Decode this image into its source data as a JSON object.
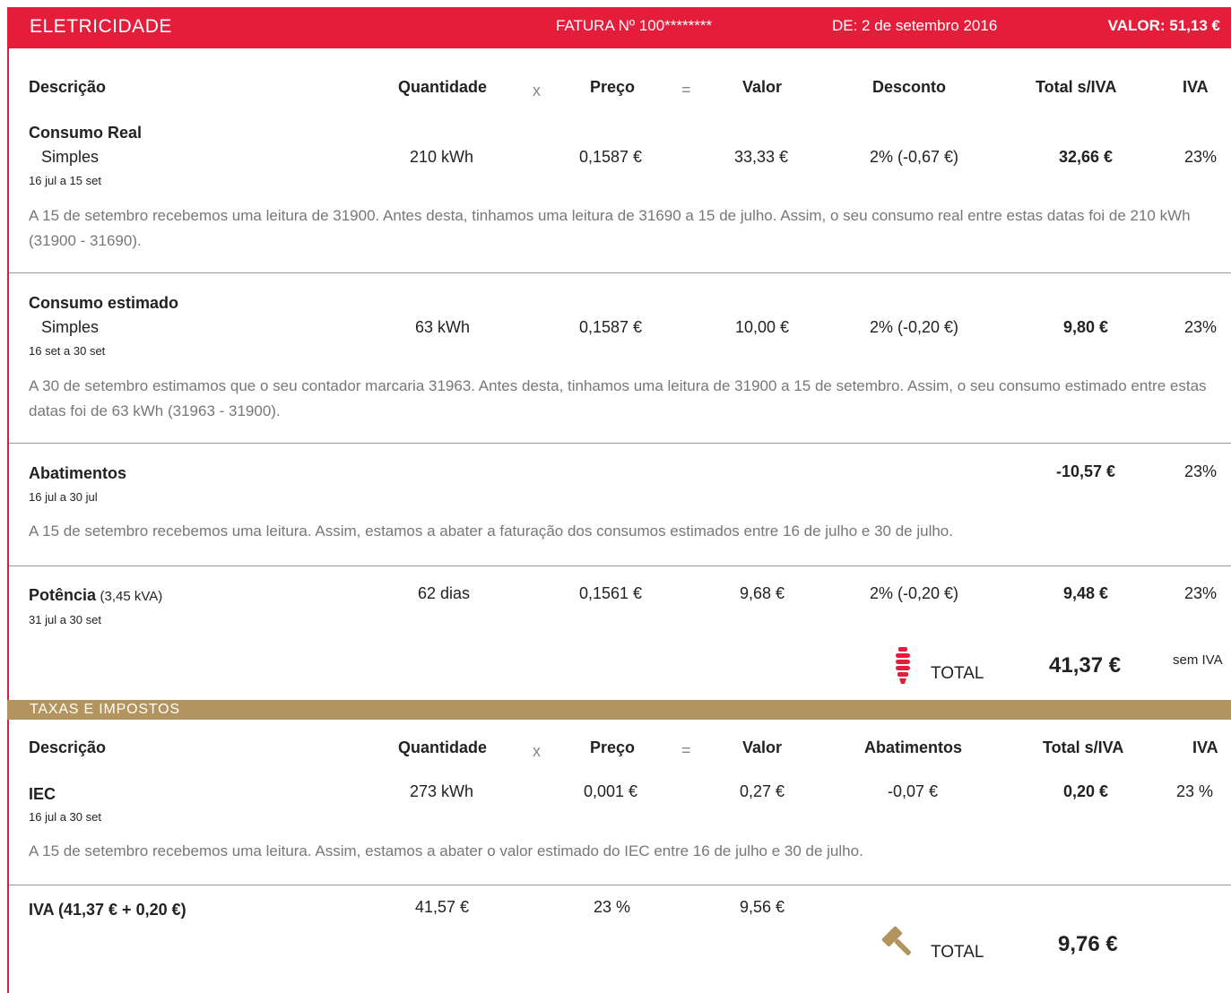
{
  "header": {
    "brand": "ELETRICIDADE",
    "invoice": "FATURA Nº 100********",
    "date": "DE: 2 de setembro 2016",
    "amount": "VALOR: 51,13 €"
  },
  "columns": {
    "desc": "Descrição",
    "qty": "Quantidade",
    "x": "x",
    "price": "Preço",
    "eq": "=",
    "value": "Valor",
    "discount": "Desconto",
    "total": "Total s/IVA",
    "vat": "IVA"
  },
  "rows": [
    {
      "title": "Consumo Real",
      "sub": "Simples",
      "period": "16 jul a 15 set",
      "qty": "210 kWh",
      "price": "0,1587 €",
      "value": "33,33 €",
      "discount": "2% (-0,67 €)",
      "total": "32,66 €",
      "vat": "23%",
      "note": "A 15 de setembro recebemos uma leitura de 31900. Antes desta, tinhamos uma leitura de 31690 a 15 de julho. Assim, o seu consumo real entre estas datas foi de 210 kWh (31900 - 31690)."
    },
    {
      "title": "Consumo estimado",
      "sub": "Simples",
      "period": "16 set a 30 set",
      "qty": "63 kWh",
      "price": "0,1587 €",
      "value": "10,00 €",
      "discount": "2% (-0,20 €)",
      "total": "9,80 €",
      "vat": "23%",
      "note": "A 30 de setembro estimamos que o seu contador marcaria 31963. Antes desta, tinhamos uma leitura de 31900 a 15 de setembro. Assim, o seu consumo estimado entre estas datas foi de 63 kWh (31963 - 31900)."
    },
    {
      "title": "Abatimentos",
      "period": "16 jul a 30 jul",
      "total": "-10,57 €",
      "vat": "23%",
      "note": "A 15 de setembro recebemos uma leitura. Assim, estamos a abater a faturação dos consumos estimados entre 16 de julho e 30 de julho."
    },
    {
      "title": "Potência",
      "title_extra": "(3,45 kVA)",
      "period": "31 jul a 30 set",
      "qty": "62 dias",
      "price": "0,1561 €",
      "value": "9,68 €",
      "discount": "2% (-0,20 €)",
      "total": "9,48 €",
      "vat": "23%"
    }
  ],
  "electricity_total": {
    "label": "TOTAL",
    "value": "41,37 €",
    "suffix": "sem IVA",
    "icon": "light-bulb-icon",
    "icon_color": "#e41d3b"
  },
  "taxes": {
    "title": "TAXAS E IMPOSTOS",
    "columns": {
      "desc": "Descrição",
      "qty": "Quantidade",
      "x": "x",
      "price": "Preço",
      "eq": "=",
      "value": "Valor",
      "discount": "Abatimentos",
      "total": "Total s/IVA",
      "vat": "IVA"
    },
    "iec": {
      "title": "IEC",
      "period": "16 jul a 30 set",
      "qty": "273 kWh",
      "price": "0,001 €",
      "value": "0,27 €",
      "discount": "-0,07 €",
      "total": "0,20 €",
      "vat": "23 %",
      "note": "A 15 de setembro recebemos uma leitura. Assim, estamos a abater o valor estimado do IEC entre 16 de julho e 30 de julho."
    },
    "iva": {
      "title": "IVA (41,37 € + 0,20 €)",
      "qty": "41,57 €",
      "price": "23 %",
      "value": "9,56 €"
    },
    "total": {
      "label": "TOTAL",
      "value": "9,76 €",
      "icon": "gavel-icon",
      "icon_color": "#b4945e"
    }
  },
  "colors": {
    "red": "#e41d3b",
    "gold": "#b4945e"
  }
}
